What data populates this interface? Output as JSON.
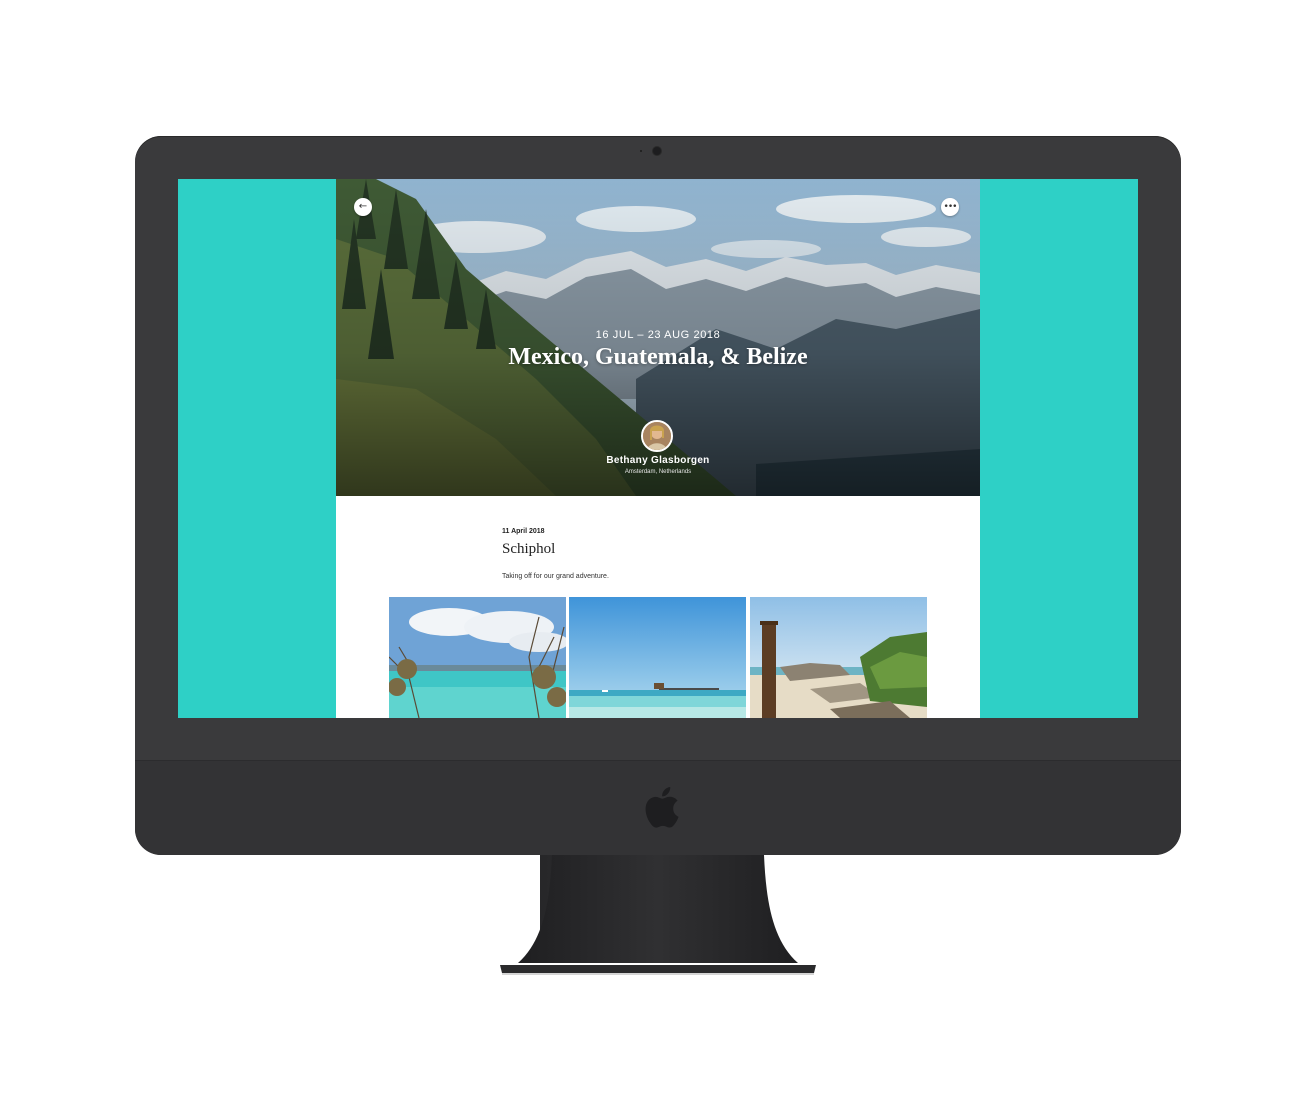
{
  "colors": {
    "screen_background": "#2ed0c6",
    "monitor_body": "#3a3a3c",
    "page_background": "#ffffff"
  },
  "hero": {
    "back_icon": "arrow-left-icon",
    "back_glyph": "←",
    "more_icon": "more-dots-icon",
    "more_glyph": "•••",
    "dates": "16 JUL – 23 AUG 2018",
    "title": "Mexico, Guatemala, & Belize",
    "author": {
      "name": "Bethany Glasborgen",
      "location": "Amsterdam, Netherlands"
    }
  },
  "entry": {
    "date": "11 April 2018",
    "title": "Schiphol",
    "text": "Taking off for our grand adventure."
  },
  "photos": [
    "beach-lagoon-photo",
    "beach-pier-photo",
    "beach-rocks-photo"
  ]
}
